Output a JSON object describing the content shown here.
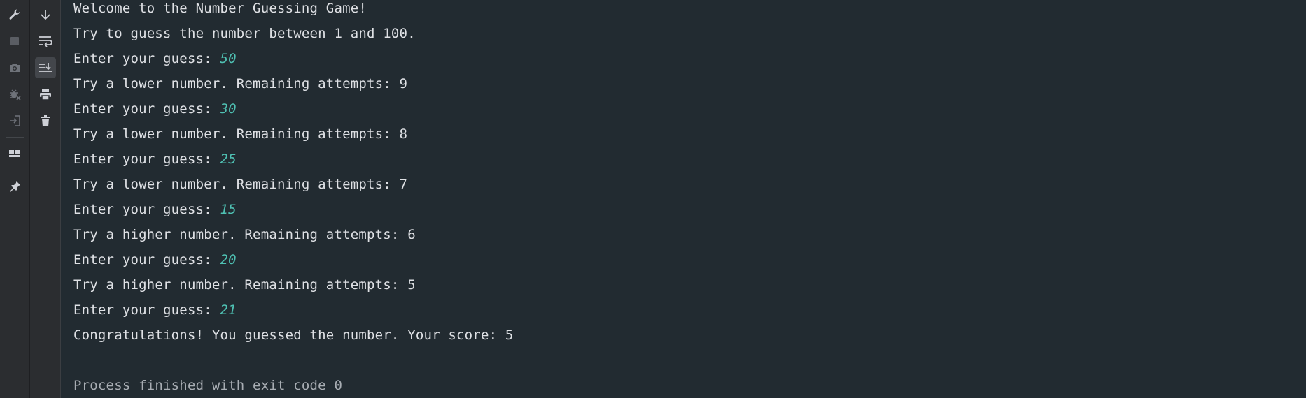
{
  "toolbar_left": {
    "items": [
      {
        "icon": "wrench-icon"
      },
      {
        "icon": "stop-icon"
      },
      {
        "icon": "camera-icon"
      },
      {
        "icon": "debug-icon"
      },
      {
        "icon": "login-icon"
      },
      {
        "icon": "layout-icon"
      },
      {
        "icon": "pin-icon"
      }
    ]
  },
  "toolbar_right": {
    "items": [
      {
        "icon": "arrow-down-icon"
      },
      {
        "icon": "soft-wrap-icon"
      },
      {
        "icon": "scroll-to-end-icon",
        "active": true
      },
      {
        "icon": "print-icon"
      },
      {
        "icon": "trash-icon"
      }
    ]
  },
  "colors": {
    "background": "#222b31",
    "text": "#dfe1e5",
    "user_input": "#4fc1b3",
    "muted": "#a8adb3"
  },
  "console": {
    "lines": [
      {
        "text": "Welcome to the Number Guessing Game!"
      },
      {
        "text": "Try to guess the number between 1 and 100."
      },
      {
        "prompt": "Enter your guess: ",
        "input": "50"
      },
      {
        "text": "Try a lower number. Remaining attempts: 9"
      },
      {
        "prompt": "Enter your guess: ",
        "input": "30"
      },
      {
        "text": "Try a lower number. Remaining attempts: 8"
      },
      {
        "prompt": "Enter your guess: ",
        "input": "25"
      },
      {
        "text": "Try a lower number. Remaining attempts: 7"
      },
      {
        "prompt": "Enter your guess: ",
        "input": "15"
      },
      {
        "text": "Try a higher number. Remaining attempts: 6"
      },
      {
        "prompt": "Enter your guess: ",
        "input": "20"
      },
      {
        "text": "Try a higher number. Remaining attempts: 5"
      },
      {
        "prompt": "Enter your guess: ",
        "input": "21"
      },
      {
        "text": "Congratulations! You guessed the number. Your score: 5"
      },
      {
        "text": ""
      },
      {
        "text": "Process finished with exit code 0",
        "muted": true
      }
    ]
  }
}
